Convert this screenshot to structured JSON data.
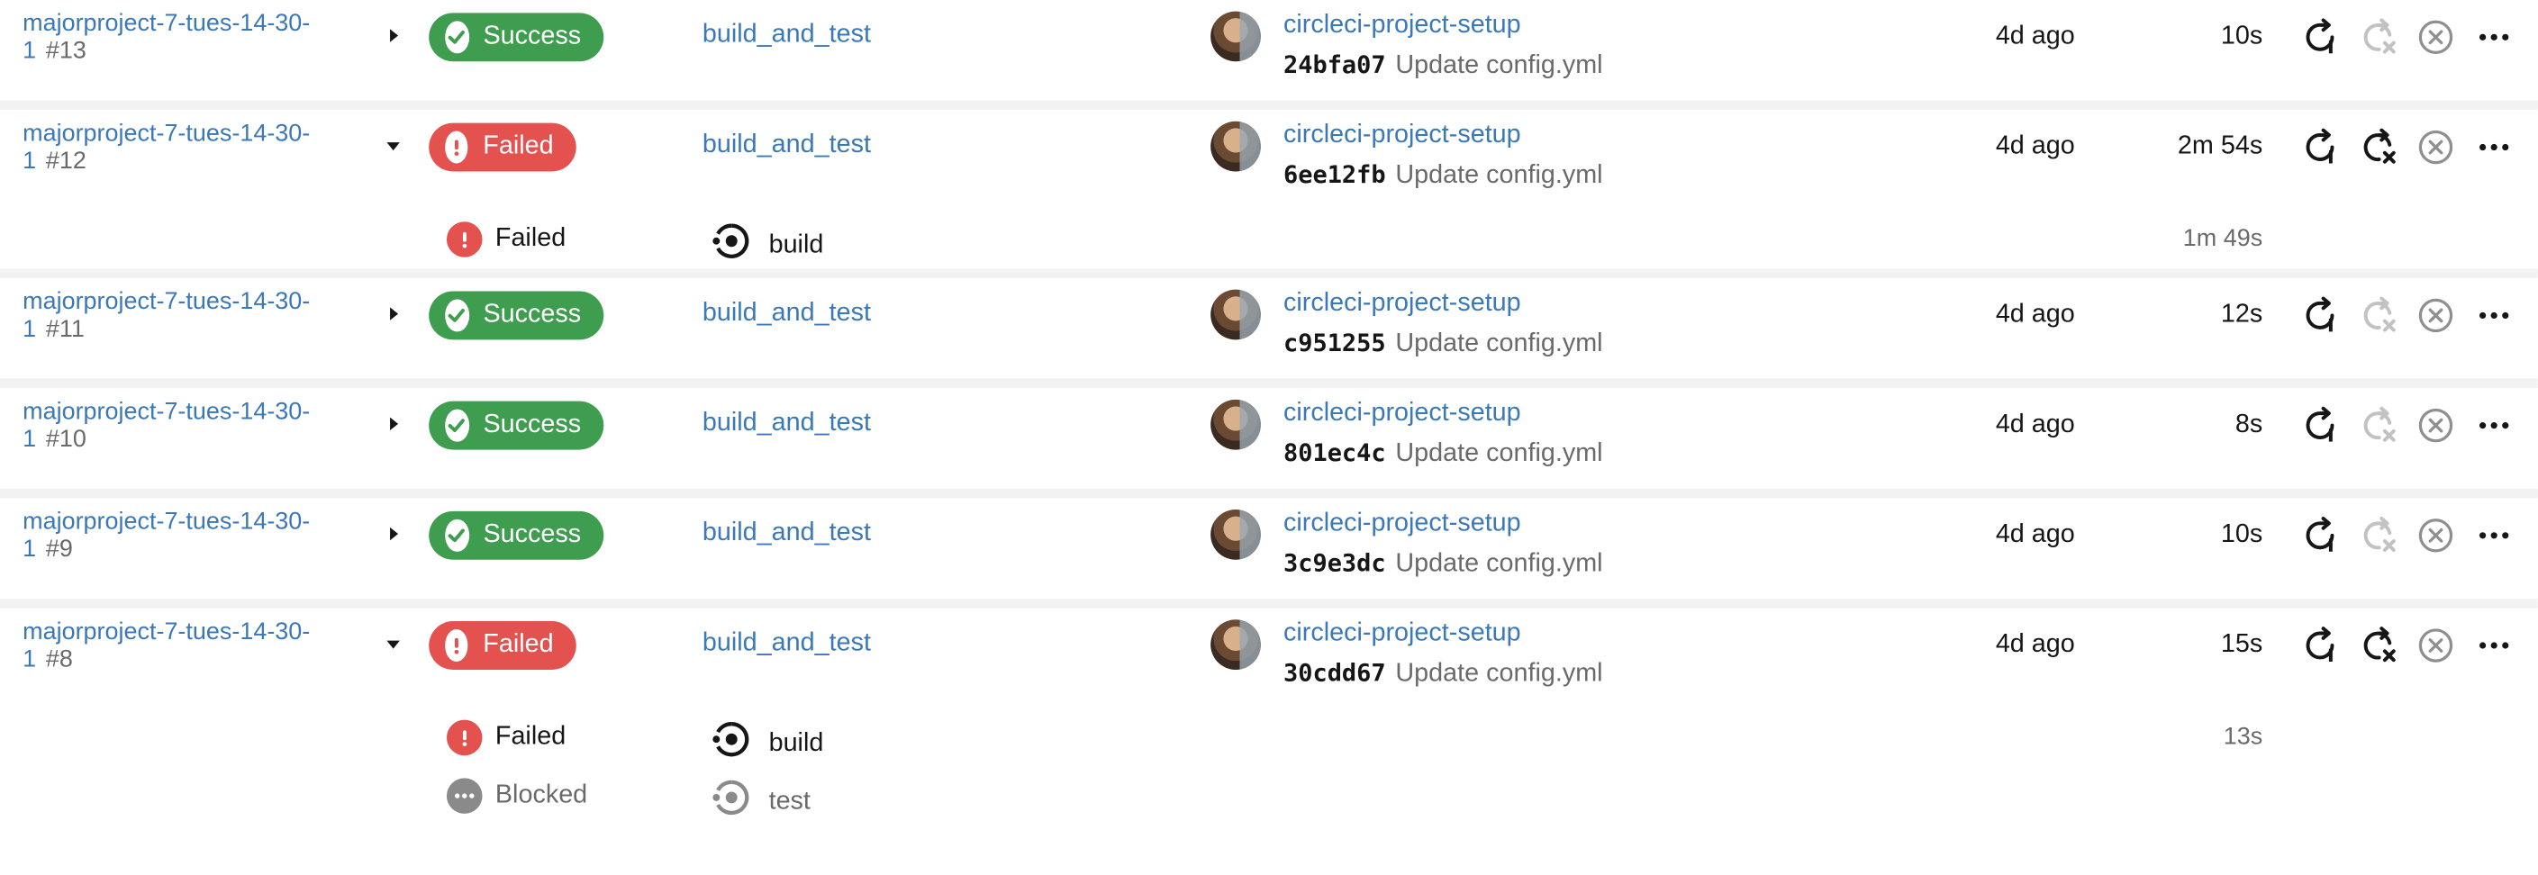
{
  "colors": {
    "link": "#3b78b8",
    "success": "#3f9d4f",
    "failed": "#e4524f",
    "blocked": "#8a8a8a",
    "muted": "#6a6a6a",
    "separator": "#f2f2f2"
  },
  "pipelines": [
    {
      "project": "majorproject-7-tues-14-30-1",
      "number": "#13",
      "expanded": false,
      "status": "success",
      "status_label": "Success",
      "workflow": "build_and_test",
      "author": "circleci-project-setup",
      "sha": "24bfa07",
      "message": "Update config.yml",
      "age": "4d ago",
      "duration": "10s",
      "rerun_failed_enabled": false,
      "jobs": []
    },
    {
      "project": "majorproject-7-tues-14-30-1",
      "number": "#12",
      "expanded": true,
      "status": "failed",
      "status_label": "Failed",
      "workflow": "build_and_test",
      "author": "circleci-project-setup",
      "sha": "6ee12fb",
      "message": "Update config.yml",
      "age": "4d ago",
      "duration": "2m 54s",
      "rerun_failed_enabled": true,
      "jobs": [
        {
          "status": "failed",
          "status_label": "Failed",
          "name": "build",
          "duration": "1m 49s"
        }
      ]
    },
    {
      "project": "majorproject-7-tues-14-30-1",
      "number": "#11",
      "expanded": false,
      "status": "success",
      "status_label": "Success",
      "workflow": "build_and_test",
      "author": "circleci-project-setup",
      "sha": "c951255",
      "message": "Update config.yml",
      "age": "4d ago",
      "duration": "12s",
      "rerun_failed_enabled": false,
      "jobs": []
    },
    {
      "project": "majorproject-7-tues-14-30-1",
      "number": "#10",
      "expanded": false,
      "status": "success",
      "status_label": "Success",
      "workflow": "build_and_test",
      "author": "circleci-project-setup",
      "sha": "801ec4c",
      "message": "Update config.yml",
      "age": "4d ago",
      "duration": "8s",
      "rerun_failed_enabled": false,
      "jobs": []
    },
    {
      "project": "majorproject-7-tues-14-30-1",
      "number": "#9",
      "expanded": false,
      "status": "success",
      "status_label": "Success",
      "workflow": "build_and_test",
      "author": "circleci-project-setup",
      "sha": "3c9e3dc",
      "message": "Update config.yml",
      "age": "4d ago",
      "duration": "10s",
      "rerun_failed_enabled": false,
      "jobs": []
    },
    {
      "project": "majorproject-7-tues-14-30-1",
      "number": "#8",
      "expanded": true,
      "status": "failed",
      "status_label": "Failed",
      "workflow": "build_and_test",
      "author": "circleci-project-setup",
      "sha": "30cdd67",
      "message": "Update config.yml",
      "age": "4d ago",
      "duration": "15s",
      "rerun_failed_enabled": true,
      "jobs": [
        {
          "status": "failed",
          "status_label": "Failed",
          "name": "build",
          "duration": "13s"
        },
        {
          "status": "blocked",
          "status_label": "Blocked",
          "name": "test",
          "duration": ""
        }
      ]
    }
  ],
  "icons": {
    "expand": "chevron-right-icon",
    "collapse": "chevron-down-icon",
    "success": "check-circle-icon",
    "failed": "exclamation-circle-icon",
    "blocked": "dots-circle-icon",
    "job": "job-icon",
    "rerun": "rerun-icon",
    "rerun_failed": "rerun-failed-icon",
    "cancel": "cancel-icon",
    "more": "more-icon"
  }
}
